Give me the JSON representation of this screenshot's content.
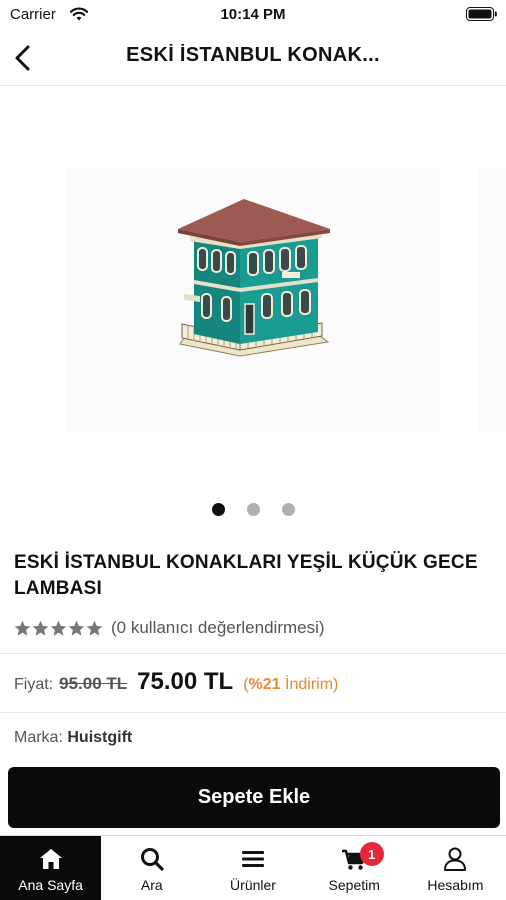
{
  "status_bar": {
    "carrier": "Carrier",
    "time": "10:14 PM"
  },
  "nav": {
    "title": "ESKİ İSTANBUL KONAK..."
  },
  "gallery": {
    "page_count": 3,
    "active_index": 0
  },
  "product": {
    "title": "ESKİ İSTANBUL KONAKLARI YEŞİL KÜÇÜK GECE LAMBASI",
    "rating_stars": 5,
    "rating_value": 0,
    "rating_text": "(0 kullanıcı değerlendirmesi)",
    "price_label": "Fiyat:",
    "old_price": "95.00 TL",
    "new_price": "75.00 TL",
    "discount_open": "(",
    "discount_percent": "%21",
    "discount_word": " İndirim)",
    "brand_label": "Marka:",
    "brand_value": "Huistgift"
  },
  "actions": {
    "add_to_cart": "Sepete Ekle"
  },
  "tab_bar": {
    "items": [
      {
        "label": "Ana Sayfa",
        "icon": "home-icon"
      },
      {
        "label": "Ara",
        "icon": "search-icon"
      },
      {
        "label": "Ürünler",
        "icon": "menu-icon"
      },
      {
        "label": "Sepetim",
        "icon": "cart-icon",
        "badge": "1"
      },
      {
        "label": "Hesabım",
        "icon": "user-icon"
      }
    ],
    "active_index": 0
  },
  "colors": {
    "primary": "#0a0a0a",
    "discount": "#e8892d",
    "badge": "#e5283a",
    "house_teal": "#1a9c92",
    "roof": "#9c5a52"
  }
}
